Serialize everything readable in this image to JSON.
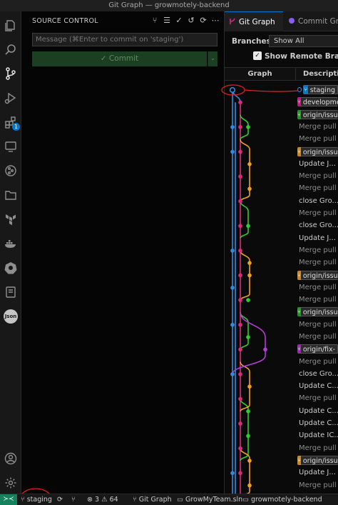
{
  "window": {
    "title": "Git Graph — growmotely-backend"
  },
  "activity_bar": {
    "items": [
      {
        "name": "explorer-icon"
      },
      {
        "name": "search-icon"
      },
      {
        "name": "source-control-icon"
      },
      {
        "name": "run-debug-icon"
      },
      {
        "name": "extensions-icon",
        "badge": "1"
      },
      {
        "name": "remote-explorer-icon"
      },
      {
        "name": "git-graph-icon"
      },
      {
        "name": "folder-icon"
      },
      {
        "name": "terraform-icon"
      },
      {
        "name": "docker-icon"
      },
      {
        "name": "kubernetes-icon"
      },
      {
        "name": "book-icon"
      },
      {
        "name": "json-icon",
        "label": "Json"
      }
    ],
    "bottom": [
      {
        "name": "account-icon"
      },
      {
        "name": "settings-gear-icon"
      }
    ]
  },
  "source_control": {
    "header": "SOURCE CONTROL",
    "message_placeholder": "Message (⌘Enter to commit on 'staging')",
    "commit_label": "✓ Commit",
    "commit_dropdown": "⌄"
  },
  "git_graph": {
    "tabs": [
      {
        "label": "Git Graph",
        "active": true
      },
      {
        "label": "Commit Graph",
        "active": false
      }
    ],
    "branches_label": "Branches:",
    "branches_value": "Show All",
    "show_remote_label": "Show Remote Branches",
    "show_remote_checked": true,
    "columns": {
      "graph": "Graph",
      "description": "Description"
    },
    "rows": [
      {
        "ref": "staging",
        "ref_color": "#0b77c2"
      },
      {
        "ref": "development",
        "ref_color": "#c2187b"
      },
      {
        "ref": "origin/issue",
        "ref_color": "#1a9c1a"
      },
      {
        "text": "Merge pull"
      },
      {
        "text": "Merge pull"
      },
      {
        "ref": "origin/issue",
        "ref_color": "#d1860f"
      },
      {
        "text": "Update J..."
      },
      {
        "text": "Merge pull"
      },
      {
        "text": "Merge pull"
      },
      {
        "text": "close Gro..."
      },
      {
        "text": "Merge pull"
      },
      {
        "text": "close Gro..."
      },
      {
        "text": "Update J..."
      },
      {
        "text": "Merge pull"
      },
      {
        "text": "Merge pull"
      },
      {
        "ref": "origin/issue",
        "ref_color": "#d1860f"
      },
      {
        "text": "Merge pull"
      },
      {
        "text": "Merge pull"
      },
      {
        "ref": "origin/issue",
        "ref_color": "#1a9c1a"
      },
      {
        "text": "Merge pull"
      },
      {
        "text": "Merge pull"
      },
      {
        "ref": "origin/fix-",
        "ref_color": "#9b27b0"
      },
      {
        "text": "Merge pull"
      },
      {
        "text": "close Gro..."
      },
      {
        "text": "Update C..."
      },
      {
        "text": "Merge pull"
      },
      {
        "text": "Update C..."
      },
      {
        "text": "Update C..."
      },
      {
        "text": "Update IC..."
      },
      {
        "text": "Merge pull"
      },
      {
        "ref": "origin/issue",
        "ref_color": "#d1860f"
      },
      {
        "text": "Update J..."
      },
      {
        "text": "Merge pull"
      },
      {
        "text": "Merge pull"
      }
    ]
  },
  "status_bar": {
    "remote_icon": "remote-icon",
    "branch": "staging",
    "sync_icon": "sync-icon",
    "errors": "3",
    "warnings": "64",
    "git_graph_label": "Git Graph",
    "sln_label": "GrowMyTeam.sln",
    "project_label": "growmotely-backend"
  },
  "colors": {
    "lane_blue": "#2f8de4",
    "lane_magenta": "#e0287f",
    "lane_green": "#2ecc2e",
    "lane_orange": "#f0a020",
    "lane_purple": "#b040d0",
    "annotation_red": "#e02020"
  }
}
